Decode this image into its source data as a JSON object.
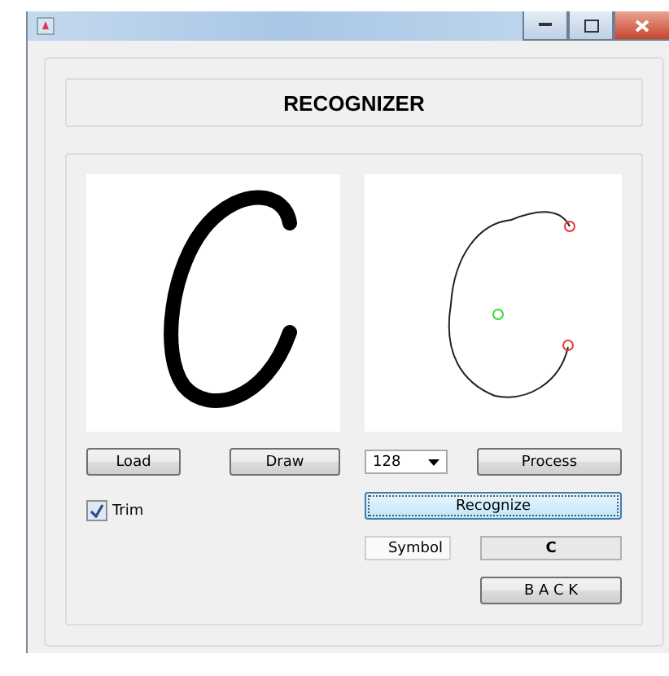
{
  "header": {
    "title": "RECOGNIZER"
  },
  "left": {
    "buttons": [
      {
        "label": "Load"
      },
      {
        "label": "Draw"
      }
    ],
    "trim": {
      "label": "Trim",
      "checked": true
    }
  },
  "right": {
    "size_select": {
      "value": "128"
    },
    "process": {
      "label": "Process"
    },
    "recognize": {
      "label": "Recognize",
      "focused": true
    },
    "symbol_label": "Symbol",
    "symbol_value": "C",
    "back": {
      "label": "B A C K"
    }
  }
}
